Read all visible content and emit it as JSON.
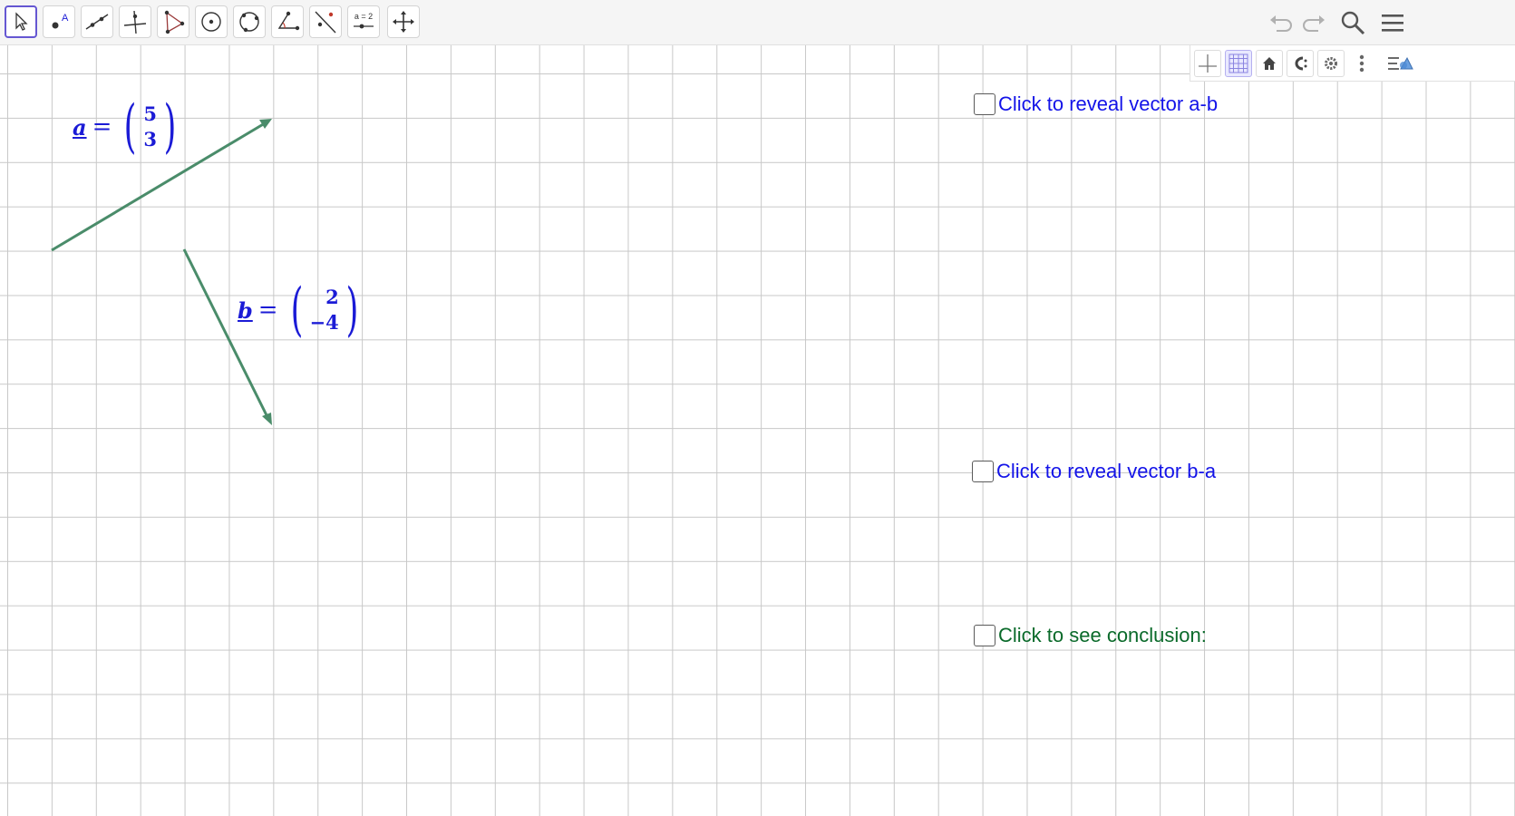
{
  "toolbar": {
    "tools": [
      {
        "name": "move-tool",
        "icon": "cursor-arrow-icon",
        "active": true
      },
      {
        "name": "point-tool",
        "icon": "point-icon",
        "label": "A"
      },
      {
        "name": "line-tool",
        "icon": "line-through-points-icon"
      },
      {
        "name": "perpendicular-line-tool",
        "icon": "perpendicular-line-icon"
      },
      {
        "name": "polygon-tool",
        "icon": "polygon-icon"
      },
      {
        "name": "circle-center-point-tool",
        "icon": "circle-center-icon"
      },
      {
        "name": "circle-three-points-tool",
        "icon": "circle-three-points-icon"
      },
      {
        "name": "angle-tool",
        "icon": "angle-icon"
      },
      {
        "name": "reflect-tool",
        "icon": "reflect-line-icon"
      },
      {
        "name": "slider-tool",
        "icon": "slider-icon",
        "label": "a = 2"
      },
      {
        "name": "move-view-tool",
        "icon": "move-graphics-icon"
      }
    ],
    "right": [
      "undo-icon",
      "redo-icon",
      "search-icon",
      "menu-icon"
    ]
  },
  "style_bar": [
    "axes-icon",
    "grid-icon",
    "home-icon",
    "snap-icon",
    "settings-icon",
    "more-vert-icon",
    "toggle-stylebar-icon"
  ],
  "vectors": {
    "a": {
      "name": "a",
      "eq": "=",
      "x": "5",
      "y": "3"
    },
    "b": {
      "name": "b",
      "eq": "=",
      "x": "2",
      "y": "−4"
    }
  },
  "checkboxes": [
    {
      "label": "Click to reveal vector a-b",
      "checked": false
    },
    {
      "label": "Click to reveal vector b-a",
      "checked": false
    },
    {
      "label": "Click to see conclusion:",
      "checked": false
    }
  ],
  "colors": {
    "vector_stroke": "#4a8c6a",
    "label_blue": "#1b1bd6",
    "checkbox_blue": "#1313e8",
    "checkbox_green": "#0a6a2a",
    "active_tool": "#6557d2"
  }
}
